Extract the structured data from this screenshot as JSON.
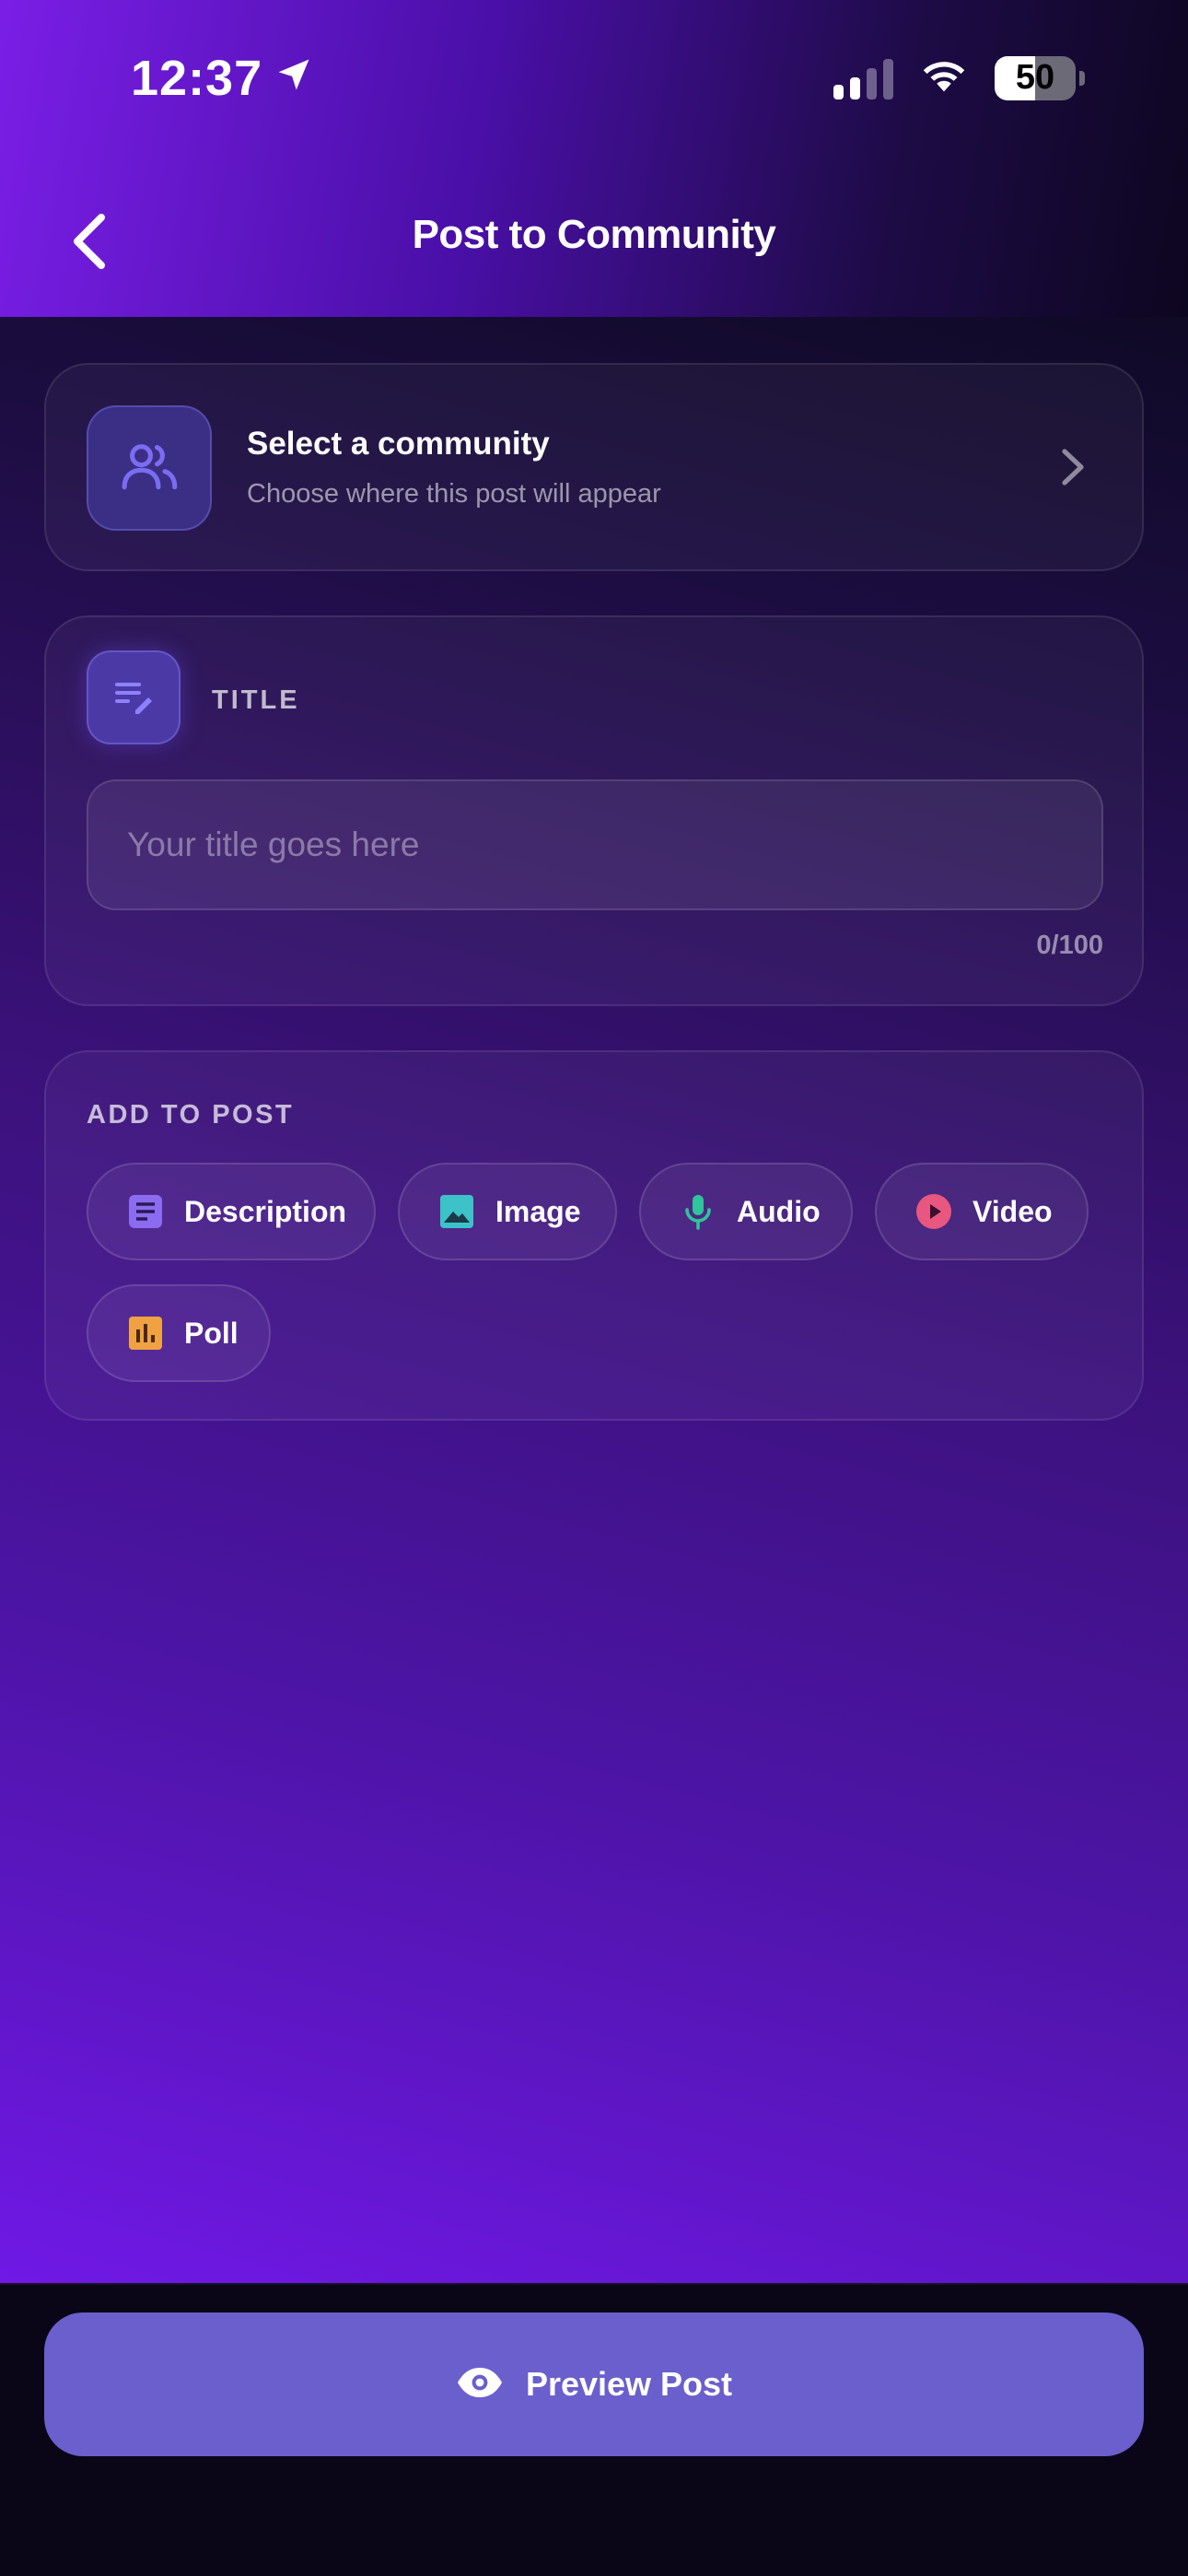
{
  "status_bar": {
    "time": "12:37",
    "battery": "50",
    "battery_level": 0.5
  },
  "nav": {
    "title": "Post to Community"
  },
  "community": {
    "title": "Select a community",
    "subtitle": "Choose where this post will appear"
  },
  "title_section": {
    "label": "TITLE",
    "placeholder": "Your title goes here",
    "value": "",
    "counter": "0/100"
  },
  "add_to_post": {
    "label": "ADD TO POST",
    "chips": [
      {
        "label": "Description",
        "icon": "description-icon",
        "color": "#8b6cf0"
      },
      {
        "label": "Image",
        "icon": "image-icon",
        "color": "#3cc2c8"
      },
      {
        "label": "Audio",
        "icon": "microphone-icon",
        "color": "#2fc49a"
      },
      {
        "label": "Video",
        "icon": "play-icon",
        "color": "#e8577f"
      },
      {
        "label": "Poll",
        "icon": "poll-icon",
        "color": "#f0a243"
      }
    ]
  },
  "footer": {
    "preview_label": "Preview Post",
    "preview_icon": "eye-icon"
  },
  "colors": {
    "accent": "#6a5fcc",
    "header_start": "#7a1ee6",
    "background_bottom": "#7018e6"
  }
}
